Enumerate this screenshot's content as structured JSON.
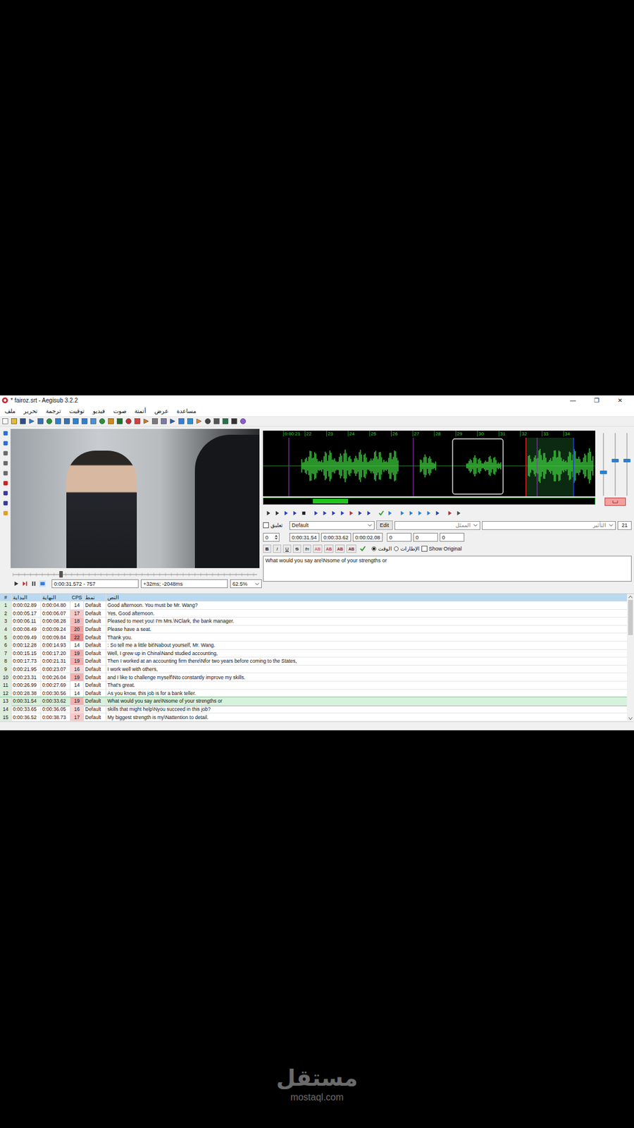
{
  "window": {
    "title": "* fairoz.srt - Aegisub 3.2.2",
    "controls": [
      "—",
      "❐",
      "✕"
    ]
  },
  "menu": [
    "ملف",
    "تحرير",
    "ترجمة",
    "توقيت",
    "فيديو",
    "صوت",
    "أتمتة",
    "عرض",
    "مساعدة"
  ],
  "video": {
    "time": "0:00:31.572 - 757",
    "offset": "+32ms; -2048ms",
    "zoom": "62.5%"
  },
  "audio": {
    "ticks": [
      "0:00:21",
      "22",
      "23",
      "24",
      "25",
      "26",
      "27",
      "28",
      "29",
      "30",
      "31",
      "32",
      "33",
      "34"
    ],
    "sliders": [
      {
        "level": 0.35
      },
      {
        "level": 0.53
      },
      {
        "level": 0.53
      }
    ]
  },
  "edit": {
    "comment": {
      "label": "تعليق",
      "checked": false
    },
    "style": "Default",
    "edit_button": "Edit",
    "actor_placeholder": "الممثل",
    "effect_placeholder": "التأثير",
    "char_count": "21",
    "layer": "0",
    "start": "0:00:31.54",
    "end": "0:00:33.62",
    "duration": "0:00:02.08",
    "margins": [
      "0",
      "0",
      "0"
    ],
    "format_buttons": [
      {
        "label": "B",
        "kind": "bold",
        "color": "#000000"
      },
      {
        "label": "I",
        "kind": "italic",
        "color": "#000000"
      },
      {
        "label": "U",
        "kind": "underline",
        "color": "#000000"
      },
      {
        "label": "S",
        "kind": "strike",
        "color": "#000000"
      },
      {
        "label": "fn",
        "kind": "font",
        "color": "#000000"
      },
      {
        "label": "AB",
        "kind": "color",
        "color": "#e06060"
      },
      {
        "label": "AB",
        "kind": "color",
        "color": "#d03a3a"
      },
      {
        "label": "AB",
        "kind": "color",
        "color": "#a82020"
      },
      {
        "label": "AB",
        "kind": "color",
        "color": "#7a1a1a"
      }
    ],
    "time_mode": [
      {
        "label": "الوقت",
        "selected": true
      },
      {
        "label": "الإطارات",
        "selected": false
      }
    ],
    "show_original": {
      "label": "Show Original",
      "checked": false
    },
    "text": "What would you say are\\Nsome of your strengths or"
  },
  "grid": {
    "columns": [
      "#",
      "البداية",
      "النهاية",
      "CPS",
      "نمط",
      "النص"
    ],
    "rows": [
      {
        "n": "1",
        "start": "0:00:02.89",
        "end": "0:00:04.80",
        "cps": "14",
        "style": "Default",
        "text": "Good afternoon. You must be Mr. Wang?",
        "color": "#ffffff",
        "selected": false
      },
      {
        "n": "2",
        "start": "0:00:05.17",
        "end": "0:00:06.07",
        "cps": "17",
        "style": "Default",
        "text": "Yes, Good afternoon.",
        "color": "#f6c8c8",
        "selected": false
      },
      {
        "n": "3",
        "start": "0:00:06.11",
        "end": "0:00:08.28",
        "cps": "18",
        "style": "Default",
        "text": "Pleased to meet you! I'm Mrs.\\NClark, the bank manager.",
        "color": "#f4bcbc",
        "selected": false
      },
      {
        "n": "4",
        "start": "0:00:08.49",
        "end": "0:00:09.24",
        "cps": "20",
        "style": "Default",
        "text": "Please have a seat.",
        "color": "#f0a4a4",
        "selected": false
      },
      {
        "n": "5",
        "start": "0:00:09.49",
        "end": "0:00:09.84",
        "cps": "22",
        "style": "Default",
        "text": "Thank you.",
        "color": "#ec8c8c",
        "selected": false
      },
      {
        "n": "6",
        "start": "0:00:12.28",
        "end": "0:00:14.93",
        "cps": "14",
        "style": "Default",
        "text": ": So tell me a little bit\\Nabout yourself, Mr. Wang.",
        "color": "#ffffff",
        "selected": false
      },
      {
        "n": "7",
        "start": "0:00:15.15",
        "end": "0:00:17.20",
        "cps": "19",
        "style": "Default",
        "text": "Well, I grew up in China\\Nand studied accounting,",
        "color": "#f2b0b0",
        "selected": false
      },
      {
        "n": "8",
        "start": "0:00:17.73",
        "end": "0:00:21.31",
        "cps": "19",
        "style": "Default",
        "text": "Then I worked at an accounting firm there\\Nfor two years before coming to the States,",
        "color": "#f2b0b0",
        "selected": false
      },
      {
        "n": "9",
        "start": "0:00:21.95",
        "end": "0:00:23.07",
        "cps": "16",
        "style": "Default",
        "text": "I work well with others,",
        "color": "#f8d6d6",
        "selected": false
      },
      {
        "n": "10",
        "start": "0:00:23.31",
        "end": "0:00:26.04",
        "cps": "19",
        "style": "Default",
        "text": "and I like to challenge myself\\Nto constantly improve my skills.",
        "color": "#f2b0b0",
        "selected": false
      },
      {
        "n": "11",
        "start": "0:00:26.99",
        "end": "0:00:27.69",
        "cps": "14",
        "style": "Default",
        "text": "That's great.",
        "color": "#ffffff",
        "selected": false
      },
      {
        "n": "12",
        "start": "0:00:28.38",
        "end": "0:00:30.56",
        "cps": "14",
        "style": "Default",
        "text": "As you know, this job is for a bank teller.",
        "color": "#ffffff",
        "selected": false
      },
      {
        "n": "13",
        "start": "0:00:31.54",
        "end": "0:00:33.62",
        "cps": "19",
        "style": "Default",
        "text": "What would you say are\\Nsome of your strengths or",
        "color": "#f2b0b0",
        "selected": true
      },
      {
        "n": "14",
        "start": "0:00:33.65",
        "end": "0:00:36.05",
        "cps": "16",
        "style": "Default",
        "text": "skills that might help\\Nyou succeed in this job?",
        "color": "#f8d6d6",
        "selected": false
      },
      {
        "n": "15",
        "start": "0:00:36.52",
        "end": "0:00:38.73",
        "cps": "17",
        "style": "Default",
        "text": "My biggest strength is my\\Nattention to detail.",
        "color": "#f6c8c8",
        "selected": false
      }
    ]
  },
  "watermark": {
    "logo": "مستقل",
    "url": "mostaql.com"
  }
}
